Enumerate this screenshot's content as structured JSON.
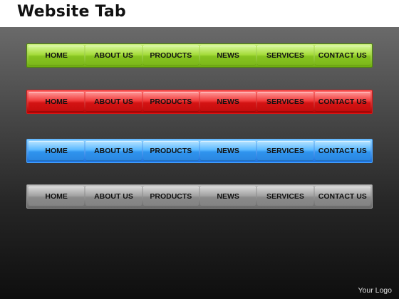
{
  "header": {
    "title": "Website Tab"
  },
  "tab_labels": [
    "HOME",
    "ABOUT US",
    "PRODUCTS",
    "NEWS",
    "SERVICES",
    "CONTACT US"
  ],
  "bars": [
    {
      "color": "#8cc63f",
      "tabs": [
        "HOME",
        "ABOUT US",
        "PRODUCTS",
        "NEWS",
        "SERVICES",
        "CONTACT US"
      ]
    },
    {
      "color": "#e02020",
      "tabs": [
        "HOME",
        "ABOUT US",
        "PRODUCTS",
        "NEWS",
        "SERVICES",
        "CONTACT US"
      ]
    },
    {
      "color": "#3aa0f5",
      "tabs": [
        "HOME",
        "ABOUT US",
        "PRODUCTS",
        "NEWS",
        "SERVICES",
        "CONTACT US"
      ]
    },
    {
      "color": "#9a9a9a",
      "tabs": [
        "HOME",
        "ABOUT US",
        "PRODUCTS",
        "NEWS",
        "SERVICES",
        "CONTACT US"
      ]
    }
  ],
  "footer": {
    "logo_text": "Your Logo"
  }
}
